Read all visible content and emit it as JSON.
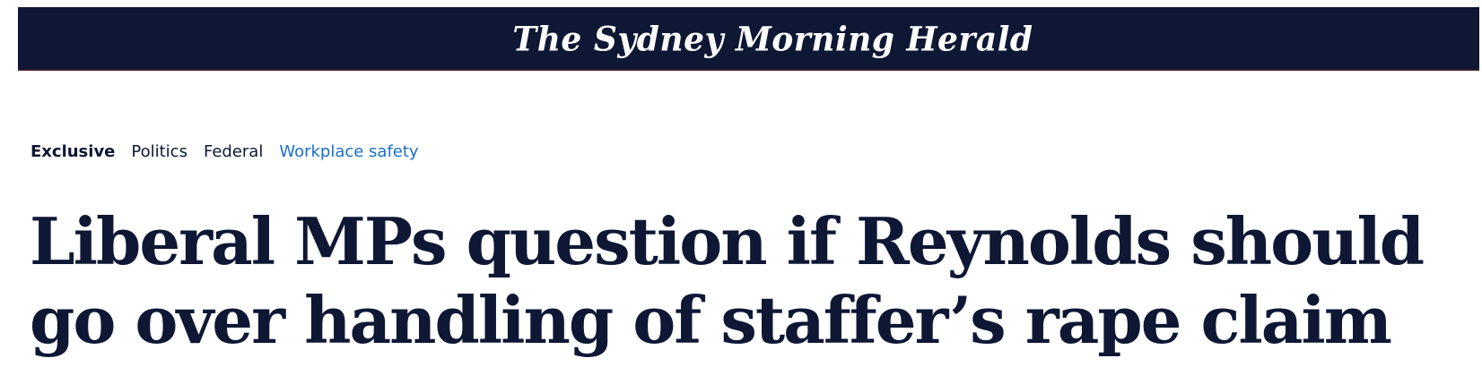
{
  "masthead": {
    "logo_text": "The Sydney Morning Herald",
    "background_color": "#0e1835"
  },
  "tags": {
    "exclusive": "Exclusive",
    "politics": "Politics",
    "federal": "Federal",
    "topic": "Workplace safety",
    "topic_color": "#1a6fc9"
  },
  "article": {
    "headline": "Liberal MPs question if Reynolds should go over handling of staffer’s rape claim"
  }
}
